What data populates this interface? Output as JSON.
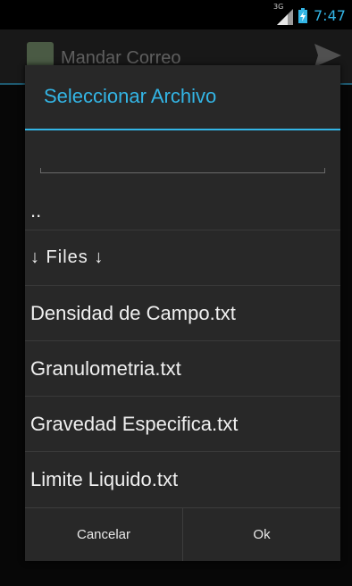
{
  "status_bar": {
    "network": "3G",
    "time": "7:47"
  },
  "background_app": {
    "title": "Mandar Correo"
  },
  "dialog": {
    "title": "Seleccionar Archivo",
    "filter": {
      "value": "",
      "placeholder": ""
    },
    "items": [
      {
        "label": ".."
      },
      {
        "label": "↓ Files ↓"
      },
      {
        "label": "Densidad de Campo.txt"
      },
      {
        "label": "Granulometria.txt"
      },
      {
        "label": "Gravedad Especifica.txt"
      },
      {
        "label": "Limite Liquido.txt"
      }
    ],
    "buttons": {
      "cancel": "Cancelar",
      "ok": "Ok"
    }
  },
  "colors": {
    "accent": "#33b5e5",
    "dialog_bg": "#282828",
    "divider": "#3a3a3a"
  }
}
